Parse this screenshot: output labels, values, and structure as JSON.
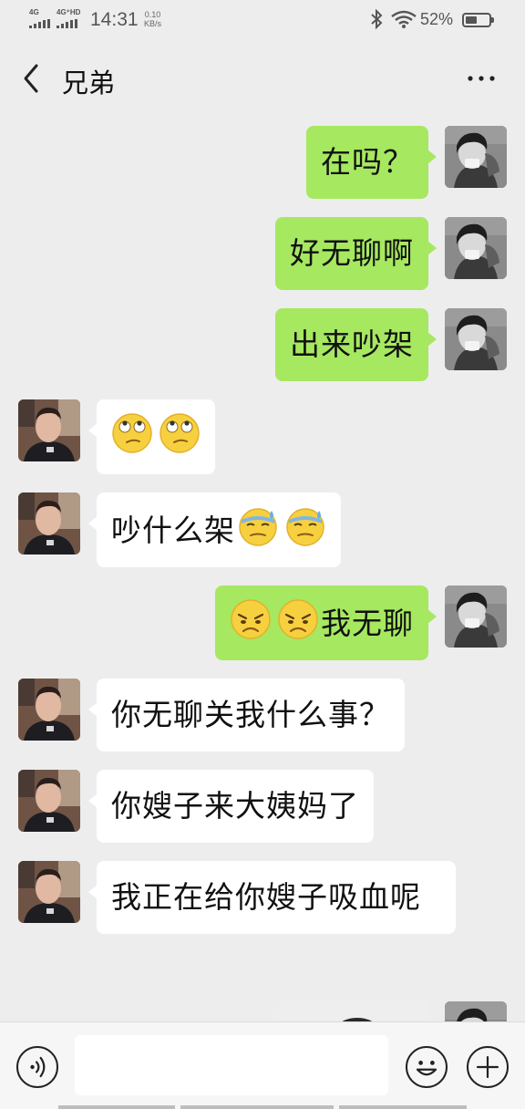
{
  "status_bar": {
    "network1": "4G",
    "network2": "4G⁺HD",
    "time": "14:31",
    "speed_value": "0.10",
    "speed_unit": "KB/s",
    "battery_percent": "52%",
    "battery_level": 0.52
  },
  "header": {
    "title": "兄弟",
    "back_icon": "chevron-left-icon",
    "more_icon": "more-dots-icon"
  },
  "messages": [
    {
      "sender": "me",
      "text": "在吗？"
    },
    {
      "sender": "me",
      "text": "好无聊啊"
    },
    {
      "sender": "me",
      "text": "出来吵架"
    },
    {
      "sender": "friend",
      "text": "",
      "emojis": [
        "eye-roll-emoji",
        "eye-roll-emoji"
      ]
    },
    {
      "sender": "friend",
      "text": "吵什么架",
      "emojis_after": [
        "sweat-emoji",
        "sweat-emoji"
      ]
    },
    {
      "sender": "me",
      "text": "我无聊",
      "emojis_before": [
        "sad-face-emoji",
        "sad-face-emoji"
      ]
    },
    {
      "sender": "friend",
      "text": "你无聊关我什么事？"
    },
    {
      "sender": "friend",
      "text": "你嫂子来大姨妈了"
    },
    {
      "sender": "friend",
      "text": "我正在给你嫂子吸血呢"
    },
    {
      "sender": "me",
      "text": "",
      "image": "photo-message"
    }
  ],
  "input_bar": {
    "voice_icon": "voice-icon",
    "text_value": "",
    "emoji_icon": "smiley-icon",
    "plus_icon": "plus-icon"
  },
  "colors": {
    "background": "#ededed",
    "my_bubble": "#a6e860",
    "friend_bubble": "#ffffff"
  }
}
